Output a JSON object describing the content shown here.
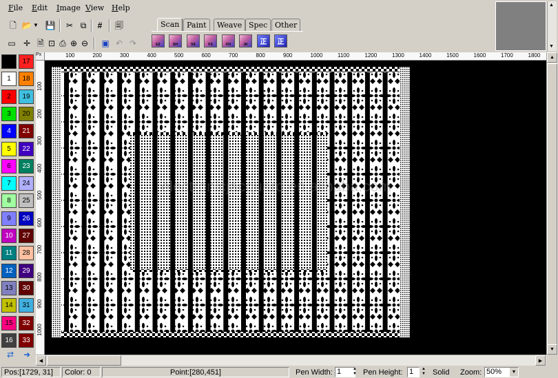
{
  "menu": {
    "file": "File",
    "edit": "Edit",
    "image": "Image",
    "view": "View",
    "help": "Help"
  },
  "toolbar_icons": {
    "row1": [
      "new-file-icon",
      "open-folder-icon",
      "dropdown-arrow-icon",
      "save-icon",
      "cut-icon",
      "copy-icon",
      "grid-icon",
      "print-preview-icon"
    ],
    "row2": [
      "screen-icon",
      "crosshair-icon",
      "new-layer-icon",
      "zoom-fit-icon",
      "print-icon",
      "zoom-in-icon",
      "zoom-out-icon",
      "select-icon",
      "undo-icon",
      "redo-icon"
    ]
  },
  "tabs": [
    "Scan",
    "Paint",
    "Weave",
    "Spec",
    "Other"
  ],
  "active_tab": "Scan",
  "scan_tools": [
    {
      "icon": "scan-ez-icon",
      "label": "EZ"
    },
    {
      "icon": "scan-sh-icon",
      "label": "SH"
    },
    {
      "icon": "scan-ss-icon",
      "label": "SS"
    },
    {
      "icon": "scan-fs-icon",
      "label": "FS"
    },
    {
      "icon": "scan-fh-icon",
      "label": "FH"
    },
    {
      "icon": "scan-jk-icon",
      "label": "JK"
    },
    {
      "icon": "weave-tool-1-icon",
      "label": "正"
    },
    {
      "icon": "weave-tool-2-icon",
      "label": "正"
    }
  ],
  "palette": [
    {
      "n": "",
      "color": "#000000"
    },
    {
      "n": "17",
      "color": "#ff2020"
    },
    {
      "n": "1",
      "color": "#ffffff"
    },
    {
      "n": "18",
      "color": "#ff8000"
    },
    {
      "n": "2",
      "color": "#ff0000"
    },
    {
      "n": "19",
      "color": "#40c0e0"
    },
    {
      "n": "3",
      "color": "#00e000"
    },
    {
      "n": "20",
      "color": "#808000"
    },
    {
      "n": "4",
      "color": "#0000ff"
    },
    {
      "n": "21",
      "color": "#800000"
    },
    {
      "n": "5",
      "color": "#ffff00"
    },
    {
      "n": "22",
      "color": "#4000c0"
    },
    {
      "n": "6",
      "color": "#ff00ff"
    },
    {
      "n": "23",
      "color": "#008060"
    },
    {
      "n": "7",
      "color": "#00ffff"
    },
    {
      "n": "24",
      "color": "#b0b0ff"
    },
    {
      "n": "8",
      "color": "#a0ffa0"
    },
    {
      "n": "25",
      "color": "#c0c0c0"
    },
    {
      "n": "9",
      "color": "#8080ff"
    },
    {
      "n": "26",
      "color": "#0000c0"
    },
    {
      "n": "10",
      "color": "#c000c0"
    },
    {
      "n": "27",
      "color": "#600000"
    },
    {
      "n": "11",
      "color": "#008080"
    },
    {
      "n": "28",
      "color": "#ffc0a0"
    },
    {
      "n": "12",
      "color": "#0060c0"
    },
    {
      "n": "29",
      "color": "#400080"
    },
    {
      "n": "13",
      "color": "#8080c0"
    },
    {
      "n": "30",
      "color": "#600000"
    },
    {
      "n": "14",
      "color": "#c0c000"
    },
    {
      "n": "31",
      "color": "#40b0e0"
    },
    {
      "n": "15",
      "color": "#ff0080"
    },
    {
      "n": "32",
      "color": "#800000"
    },
    {
      "n": "16",
      "color": "#404040"
    },
    {
      "n": "33",
      "color": "#800000"
    }
  ],
  "ruler": {
    "corner": "Px",
    "top_labels": [
      "100",
      "200",
      "300",
      "400",
      "500",
      "600",
      "700",
      "800",
      "900",
      "1000",
      "1100",
      "1200",
      "1300",
      "1400",
      "1500",
      "1600",
      "1700",
      "1800"
    ],
    "left_labels": [
      "100",
      "200",
      "300",
      "400",
      "500",
      "600",
      "700",
      "800",
      "900",
      "1000"
    ]
  },
  "watermark": "electronicjacquard.en.alibaba.com",
  "status": {
    "pos": "Pos:[1729, 31]",
    "color": "Color:  0",
    "point": "Point:[280,451]",
    "pen_width_label": "Pen Width:",
    "pen_width": "1",
    "pen_height_label": "Pen Height:",
    "pen_height": "1",
    "line_style": "Solid",
    "zoom_label": "Zoom:",
    "zoom": "50%"
  }
}
